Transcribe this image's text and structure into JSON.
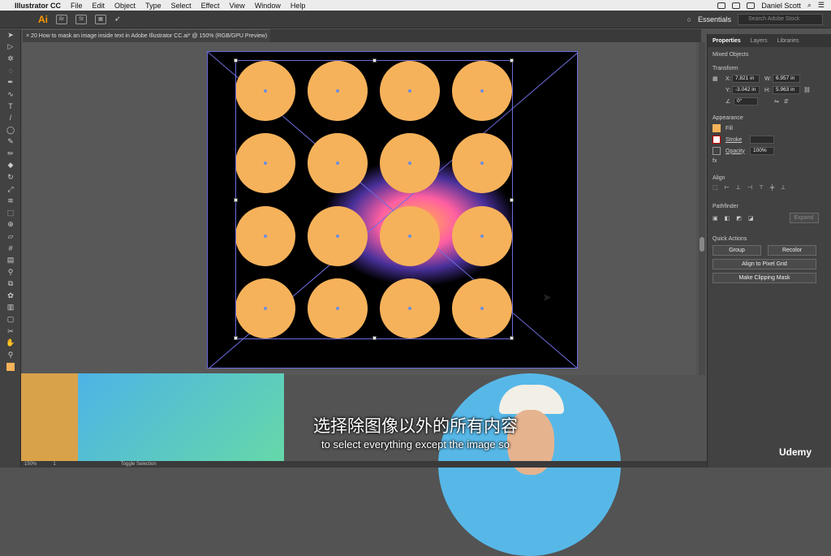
{
  "menubar": {
    "app": "Illustrator CC",
    "items": [
      "File",
      "Edit",
      "Object",
      "Type",
      "Select",
      "Effect",
      "View",
      "Window",
      "Help"
    ],
    "user": "Daniel Scott"
  },
  "appbar": {
    "logo": "Ai",
    "workspace": "Essentials",
    "search_placeholder": "Search Adobe Stock"
  },
  "doc": {
    "tab_title": "20 How to mask an image inside text in Adobe Illustrator CC.ai* @ 150% (RGB/GPU Preview)"
  },
  "panel": {
    "tabs": [
      "Properties",
      "Layers",
      "Libraries"
    ],
    "selection_type": "Mixed Objects",
    "transform": {
      "title": "Transform",
      "x": "7.821 in",
      "y": "-3.042 in",
      "w": "6.957 in",
      "h": "5.963 in",
      "angle": "0°"
    },
    "appearance": {
      "title": "Appearance",
      "fill": "Fill",
      "stroke": "Stroke",
      "opacity_label": "Opacity",
      "opacity": "100%"
    },
    "align_title": "Align",
    "pathfinder_title": "Pathfinder",
    "expand": "Expand",
    "quick_actions": {
      "title": "Quick Actions",
      "group": "Group",
      "recolor": "Recolor",
      "align_pixel": "Align to Pixel Grid",
      "clipping": "Make Clipping Mask"
    }
  },
  "status": {
    "zoom": "150%",
    "page": "1",
    "tool": "Toggle Selection"
  },
  "subtitles": {
    "cn": "选择除图像以外的所有内容",
    "en": "to select everything except the image so"
  },
  "branding": {
    "udemy": "Udemy"
  },
  "colors": {
    "fill": "#f6b25a",
    "selection": "#6d6dde"
  }
}
